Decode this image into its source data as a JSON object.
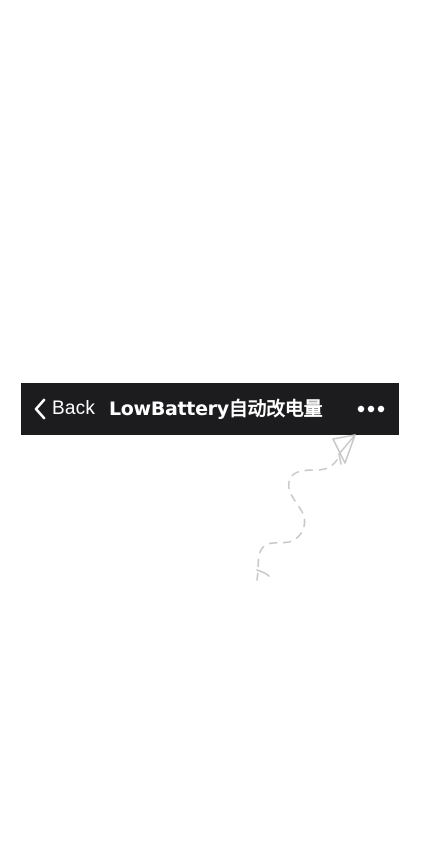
{
  "navbar": {
    "back_label": "Back",
    "title": "LowBattery自动改电量",
    "back_icon": "chevron-left-icon",
    "more_icon": "more-dots-icon"
  },
  "hint": {
    "icon": "paper-plane-dashed-trail-icon"
  },
  "colors": {
    "navbar_bg": "#1c1c1e",
    "navbar_text": "#ffffff",
    "page_bg": "#ffffff",
    "doodle_stroke": "#c8c8c8"
  }
}
